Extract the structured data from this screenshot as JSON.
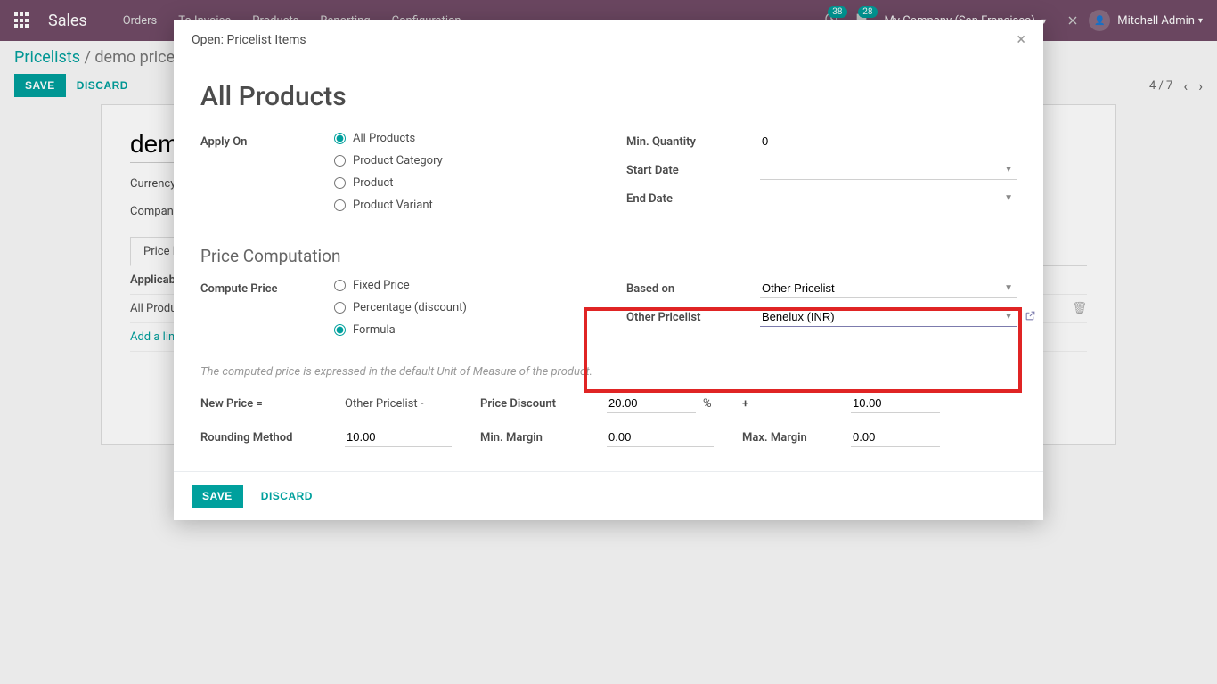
{
  "navbar": {
    "brand": "Sales",
    "menu": [
      "Orders",
      "To Invoice",
      "Products",
      "Reporting",
      "Configuration"
    ],
    "badge1": "38",
    "badge2": "28",
    "company": "My Company (San Francisco)",
    "user": "Mitchell Admin"
  },
  "breadcrumb": {
    "root": "Pricelists",
    "current": "demo price"
  },
  "cp": {
    "save": "SAVE",
    "discard": "DISCARD",
    "pager": "4 / 7"
  },
  "sheet": {
    "name": "demo",
    "currency_label": "Currency",
    "company_label": "Company",
    "tab_label": "Price Rules",
    "col_applicable": "Applicable On",
    "row1": "All Products",
    "add_line": "Add a line"
  },
  "modal": {
    "title": "Open: Pricelist Items",
    "heading": "All Products",
    "apply_on_label": "Apply On",
    "apply_on_options": {
      "all": "All Products",
      "category": "Product Category",
      "product": "Product",
      "variant": "Product Variant"
    },
    "min_qty_label": "Min. Quantity",
    "min_qty_value": "0",
    "start_date_label": "Start Date",
    "end_date_label": "End Date",
    "section_price_comp": "Price Computation",
    "compute_label": "Compute Price",
    "compute_options": {
      "fixed": "Fixed Price",
      "percent": "Percentage (discount)",
      "formula": "Formula"
    },
    "based_on_label": "Based on",
    "based_on_value": "Other Pricelist",
    "other_pricelist_label": "Other Pricelist",
    "other_pricelist_value": "Benelux (INR)",
    "help_text": "The computed price is expressed in the default Unit of Measure of the product.",
    "new_price_label": "New Price =",
    "new_price_value": "Other Pricelist -",
    "rounding_label": "Rounding Method",
    "rounding_value": "10.00",
    "discount_label": "Price Discount",
    "discount_value": "20.00",
    "percent_sign": "%",
    "plus_sign": "+",
    "surcharge_value": "10.00",
    "min_margin_label": "Min. Margin",
    "min_margin_value": "0.00",
    "max_margin_label": "Max. Margin",
    "max_margin_value": "0.00",
    "footer_save": "SAVE",
    "footer_discard": "DISCARD"
  }
}
